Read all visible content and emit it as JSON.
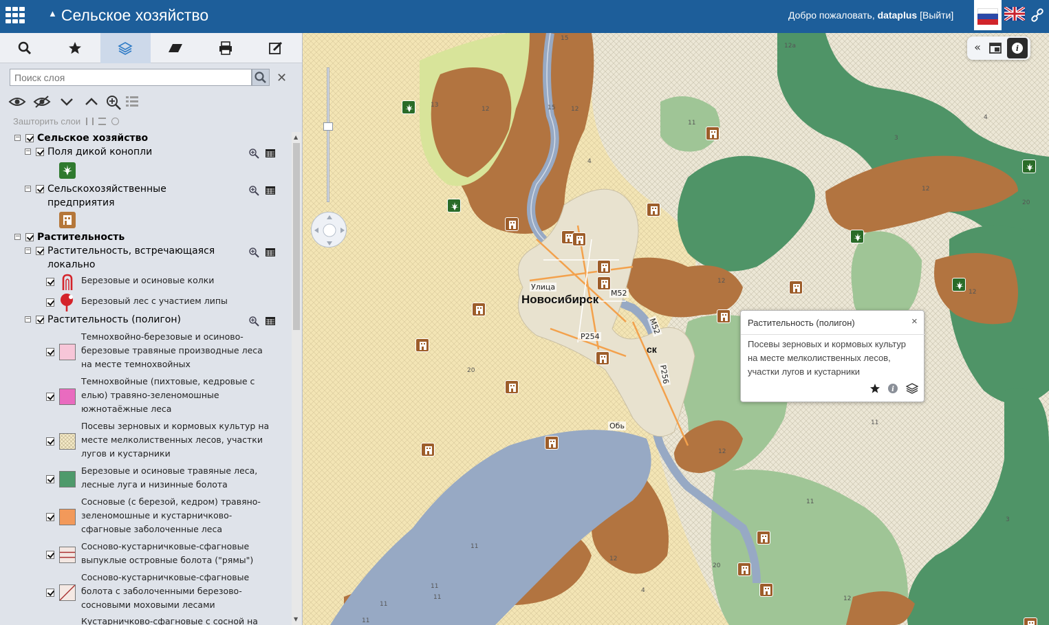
{
  "header": {
    "title": "Сельское хозяйство",
    "welcome_prefix": "Добро пожаловать,",
    "username": "dataplus",
    "logout": "[Выйти]"
  },
  "sidebar": {
    "tabs": [
      "search",
      "favorites",
      "layers",
      "erase",
      "print",
      "edit"
    ],
    "search_placeholder": "Поиск слоя",
    "order_label": "Зашторить слои",
    "tree": {
      "group1": {
        "label": "Сельское хозяйство"
      },
      "layer1": {
        "label": "Поля дикой конопли"
      },
      "layer2": {
        "label": "Сельскохозяйственные предприятия",
        "line1": "Сельскохозяйственные",
        "line2": "предприятия"
      },
      "group2": {
        "label": "Растительность"
      },
      "layer3": {
        "line1": "Растительность, встречающаяся",
        "line2": "локально"
      },
      "sym1": "Березовые и осиновые колки",
      "sym2": "Березовый лес с участием липы",
      "layer4": {
        "label": "Растительность (полигон)"
      },
      "legend": [
        {
          "lines": [
            "Темнохвойно-березовые и осиново-",
            "березовые травяные производные леса",
            "на месте темнохвойных"
          ],
          "color": "#f7c6d8"
        },
        {
          "lines": [
            "Темнохвойные (пихтовые, кедровые с",
            "елью) травяно-зеленомошные",
            "южнотаёжные леса"
          ],
          "color": "#e96bbf"
        },
        {
          "lines": [
            "Посевы зерновых и кормовых культур на",
            "месте мелколиственных лесов, участки",
            "лугов и кустарники"
          ],
          "color": "#f4eac8"
        },
        {
          "lines": [
            "Березовые и осиновые травяные леса,",
            "лесные луга и низинные болота"
          ],
          "color": "#4e9a6b"
        },
        {
          "lines": [
            "Сосновые (с березой, кедром) травяно-",
            "зеленомошные и кустарничково-",
            "сфагновые заболоченные леса"
          ],
          "color": "#f2995a"
        },
        {
          "lines": [
            "Сосново-кустарничковые-сфагновые",
            "выпуклые островные болота (\"рямы\")"
          ],
          "color": "#f3e7e2"
        },
        {
          "lines": [
            "Сосново-кустарничковые-сфагновые",
            "болота с заболоченными березово-",
            "сосновыми моховыми лесами"
          ],
          "color": "#f5e9e4"
        },
        {
          "lines": [
            "Кустарничково-сфагновые с сосной на"
          ],
          "color": "#ffffff"
        }
      ]
    }
  },
  "map": {
    "city": "Новосибирск",
    "city_partial": "ск",
    "street": "Улица",
    "roads": [
      "M52",
      "P254",
      "M52",
      "P256",
      "Обь"
    ],
    "numbers": [
      "15",
      "13",
      "12",
      "15",
      "12",
      "11",
      "4",
      "3",
      "12a",
      "4",
      "12",
      "20",
      "12",
      "20",
      "12",
      "11",
      "11",
      "12",
      "3",
      "20",
      "4",
      "11",
      "12",
      "12",
      "11",
      "11",
      "11",
      "11"
    ]
  },
  "popup": {
    "title": "Растительность (полигон)",
    "close": "×",
    "body_lines": [
      "Посевы зерновых и кормовых культур",
      "на месте мелколиственных лесов,",
      "участки лугов и кустарники"
    ]
  }
}
